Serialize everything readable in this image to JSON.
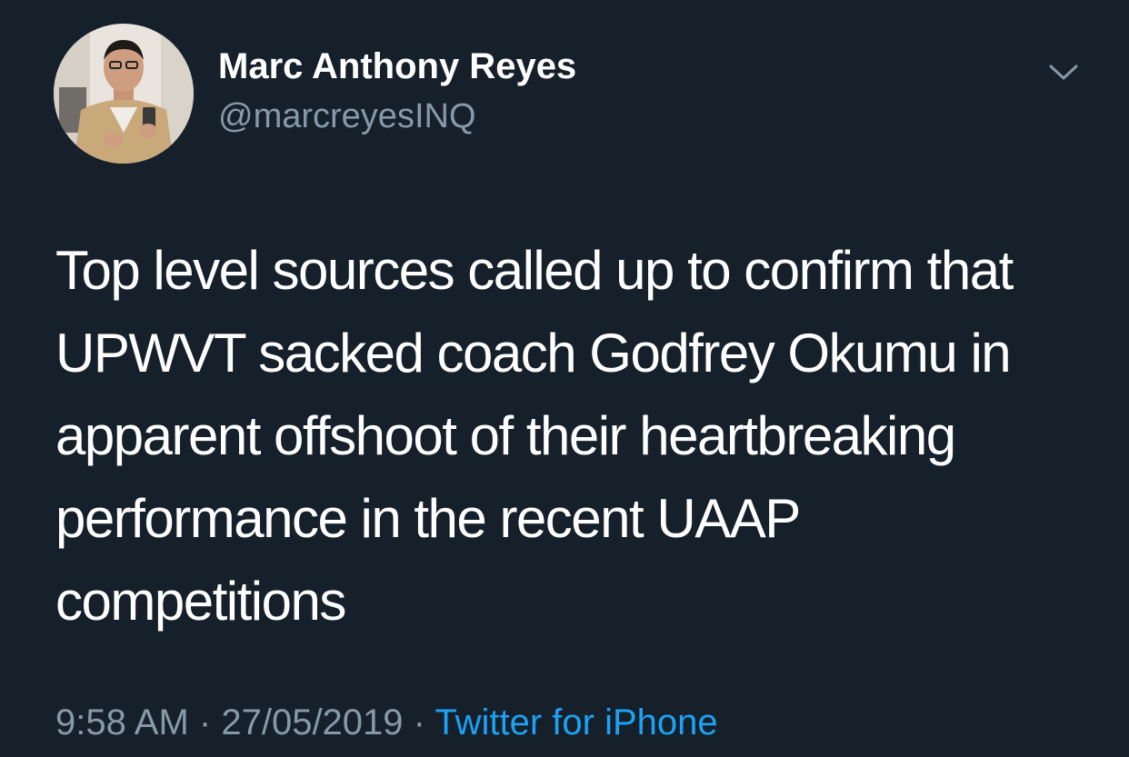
{
  "author": {
    "display_name": "Marc Anthony Reyes",
    "handle": "@marcreyesINQ"
  },
  "tweet": {
    "text_lines": [
      "Top level sources called up to confirm that",
      "UPWVT sacked coach Godfrey Okumu in",
      "apparent offshoot of their heartbreaking",
      "performance in the recent UAAP",
      "competitions"
    ]
  },
  "meta": {
    "time": "9:58 AM",
    "separator": "·",
    "date": "27/05/2019",
    "source": "Twitter for iPhone"
  },
  "icons": {
    "menu": "chevron-down-icon",
    "avatar": "profile-photo"
  },
  "colors": {
    "background": "#15202b",
    "primary_text": "#ffffff",
    "secondary_text": "#8899a6",
    "link": "#1da1f2"
  }
}
